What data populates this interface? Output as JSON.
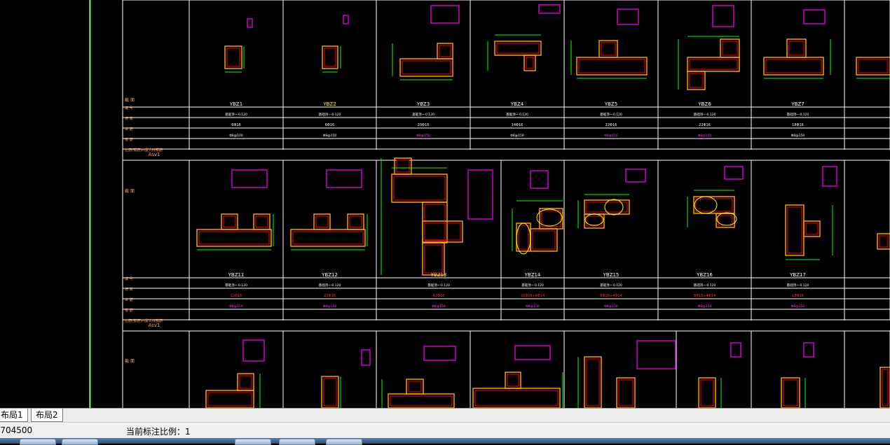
{
  "drawing": {
    "row1": {
      "row_labels": [
        "截 面",
        "编 号",
        "标 高",
        "纵 筋",
        "箍 筋",
        "拉筋(箍筋)内置大样箍筋"
      ],
      "asv_label": "Asv1",
      "columns": [
        {
          "id": "YBZ1",
          "elev": "基础顶~-0.120",
          "rebar": "6Φ16",
          "stirrup": "Φ8@100"
        },
        {
          "id": "YBZ2",
          "elev": "基础顶~-0.120",
          "rebar": "6Φ16",
          "stirrup": "Φ8@150"
        },
        {
          "id": "YBZ3",
          "elev": "基础顶~-0.120",
          "rebar": "20Φ16",
          "stirrup": "Φ8@150"
        },
        {
          "id": "YBZ4",
          "elev": "基础顶~-0.120",
          "rebar": "14Φ16",
          "stirrup": "Φ8@150"
        },
        {
          "id": "YBZ5",
          "elev": "基础顶~-0.120",
          "rebar": "22Φ16",
          "stirrup": "Φ8@150"
        },
        {
          "id": "YBZ6",
          "elev": "基础顶~-0.120",
          "rebar": "22Φ16",
          "stirrup": "Φ8@150"
        },
        {
          "id": "YBZ7",
          "elev": "基础顶~-0.120",
          "rebar": "18Φ16",
          "stirrup": "Φ8@150"
        }
      ]
    },
    "row2": {
      "row_labels": [
        "截 面",
        "编 号",
        "标 高",
        "纵 筋",
        "箍 筋",
        "拉筋(箍筋)内置大样箍筋"
      ],
      "asv_label": "Asv1",
      "columns": [
        {
          "id": "YBZ11",
          "elev": "基础顶~-0.120",
          "rebar": "22Φ16",
          "stirrup": "Φ8@150"
        },
        {
          "id": "YBZ12",
          "elev": "基础顶~-0.120",
          "rebar": "22Φ16",
          "stirrup": "Φ8@150"
        },
        {
          "id": "YBZ13",
          "elev": "基础顶~-0.120",
          "rebar": "42Φ16",
          "stirrup": "Φ8@150"
        },
        {
          "id": "YBZ14",
          "elev": "基础顶~-0.120",
          "rebar": "16Φ16+6Φ14",
          "stirrup": "Φ8@150"
        },
        {
          "id": "YBZ15",
          "elev": "基础顶~-0.120",
          "rebar": "8Φ16+4Φ14",
          "stirrup": "Φ8@150"
        },
        {
          "id": "YBZ16",
          "elev": "基础顶~-0.120",
          "rebar": "8Φ16+4Φ14",
          "stirrup": "Φ8@150"
        },
        {
          "id": "YBZ17",
          "elev": "基础顶~-0.120",
          "rebar": "18Φ16",
          "stirrup": "Φ8@150"
        }
      ]
    },
    "row3": {
      "row_labels": [
        "截 面"
      ]
    }
  },
  "tabs": [
    {
      "label": "布局1"
    },
    {
      "label": "布局2"
    }
  ],
  "status": {
    "coords": "-704500",
    "scale_text": "当前标注比例：1"
  },
  "colors": {
    "background": "#000000",
    "grid": "#ffffff",
    "rebar_outline": "#ff0000",
    "column_fill_border": "#ffaa00",
    "stirrup": "#ff00ff",
    "dimension": "#00ff00",
    "label_yellow": "#ffff00"
  }
}
